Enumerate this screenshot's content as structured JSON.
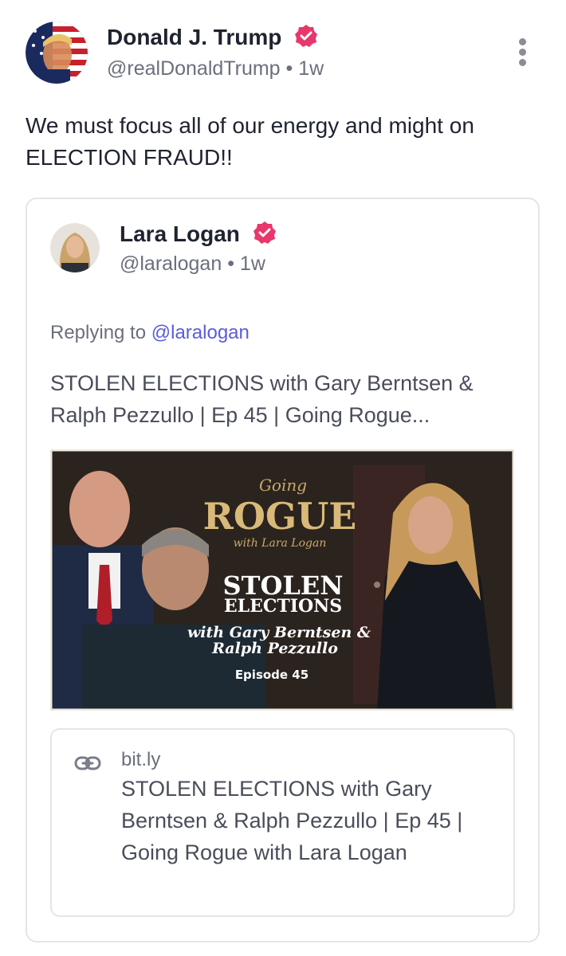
{
  "post": {
    "author_name": "Donald J. Trump",
    "author_handle": "@realDonaldTrump",
    "separator": "•",
    "age": "1w",
    "text": "We must focus all of our energy and might on ELECTION FRAUD!!"
  },
  "quote": {
    "author_name": "Lara Logan",
    "author_handle": "@laralogan",
    "separator": "•",
    "age": "1w",
    "replying_prefix": "Replying to",
    "replying_to": "@laralogan",
    "text": "STOLEN ELECTIONS with Gary Berntsen & Ralph Pezzullo | Ep 45 | Going Rogue...",
    "media": {
      "show_title_small": "Going",
      "show_title": "ROGUE",
      "show_subtitle": "with Lara Logan",
      "headline_1": "STOLEN",
      "headline_2": "ELECTIONS",
      "guests_1": "with Gary Berntsen &",
      "guests_2": "Ralph Pezzullo",
      "episode": "Episode 45"
    },
    "link": {
      "domain": "bit.ly",
      "title": "STOLEN ELECTIONS with Gary Berntsen & Ralph Pezzullo | Ep 45 | Going Rogue with Lara Logan"
    }
  },
  "colors": {
    "verified": "#e8376a",
    "accent_link": "#5b5be0",
    "muted_text": "#6b6f7c",
    "border": "#e4e5e9"
  },
  "icons": [
    "verified-badge-icon",
    "more-options-icon",
    "link-icon"
  ]
}
